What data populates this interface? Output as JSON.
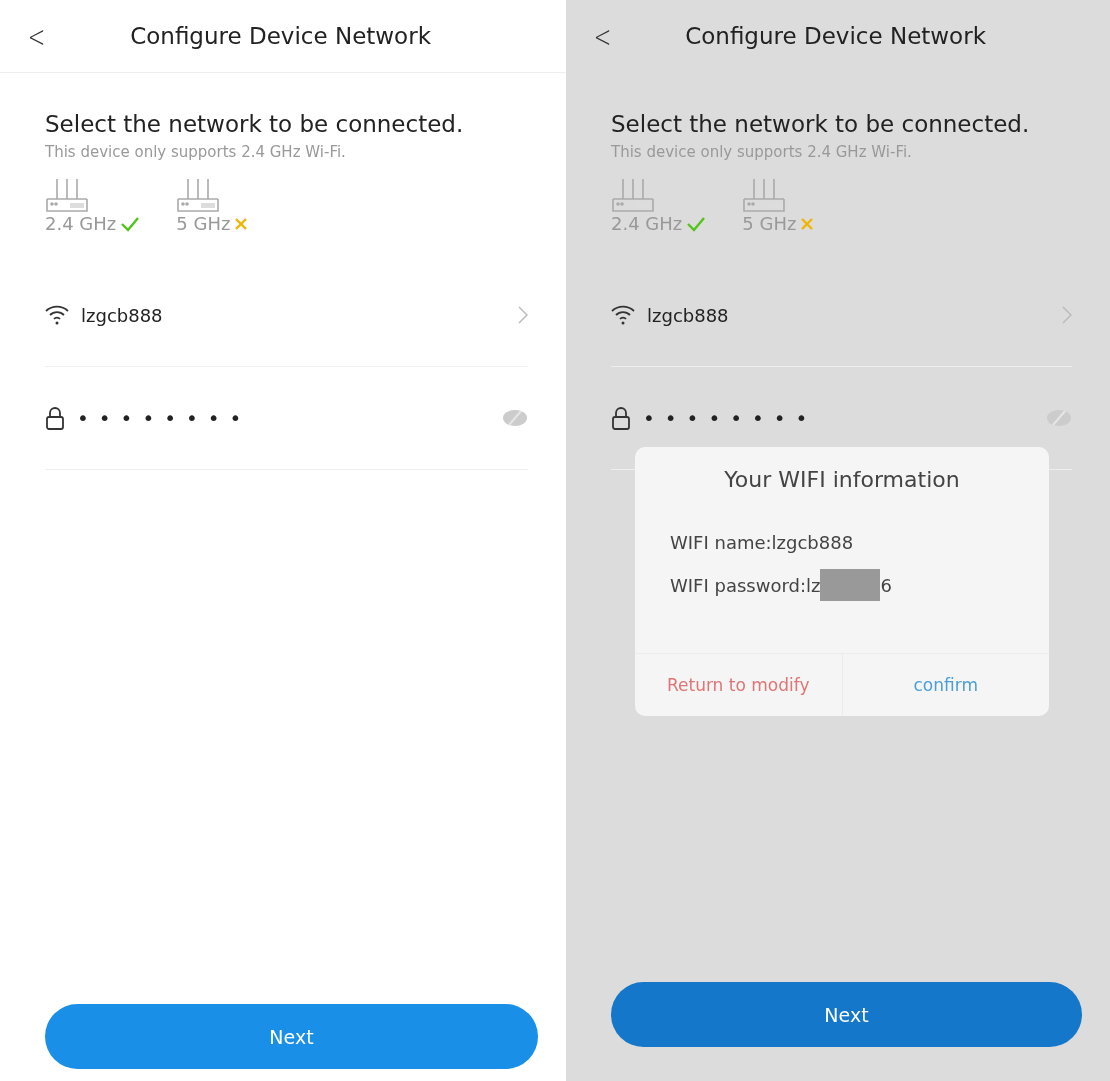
{
  "screens": [
    {
      "back": "<",
      "title": "Configure Device Network",
      "heading": "Select the network to be connected.",
      "subtitle": "This device only supports 2.4 GHz Wi-Fi.",
      "bands": [
        {
          "label": "2.4 GHz",
          "supported": true
        },
        {
          "label": "5 GHz",
          "supported": false
        }
      ],
      "network": "lzgcb888",
      "password": "••••••••",
      "button": "Next",
      "dimmed": false
    },
    {
      "back": "<",
      "title": "Configure Device Network",
      "heading": "Select the network to be connected.",
      "subtitle": "This device only supports 2.4 GHz Wi-Fi.",
      "bands": [
        {
          "label": "2.4 GHz",
          "supported": true
        },
        {
          "label": "5 GHz",
          "supported": false
        }
      ],
      "network": "lzgcb888",
      "password": "••••••••",
      "button": "Next",
      "dimmed": true,
      "dialog": {
        "title": "Your WIFI information",
        "name_line": "WIFI name:lzgcb888",
        "password_prefix": "WIFI password:lz",
        "password_suffix": "6",
        "buttons": [
          {
            "label": "Return to modify",
            "kind": "cancel"
          },
          {
            "label": "confirm",
            "kind": "confirm"
          }
        ]
      }
    }
  ]
}
